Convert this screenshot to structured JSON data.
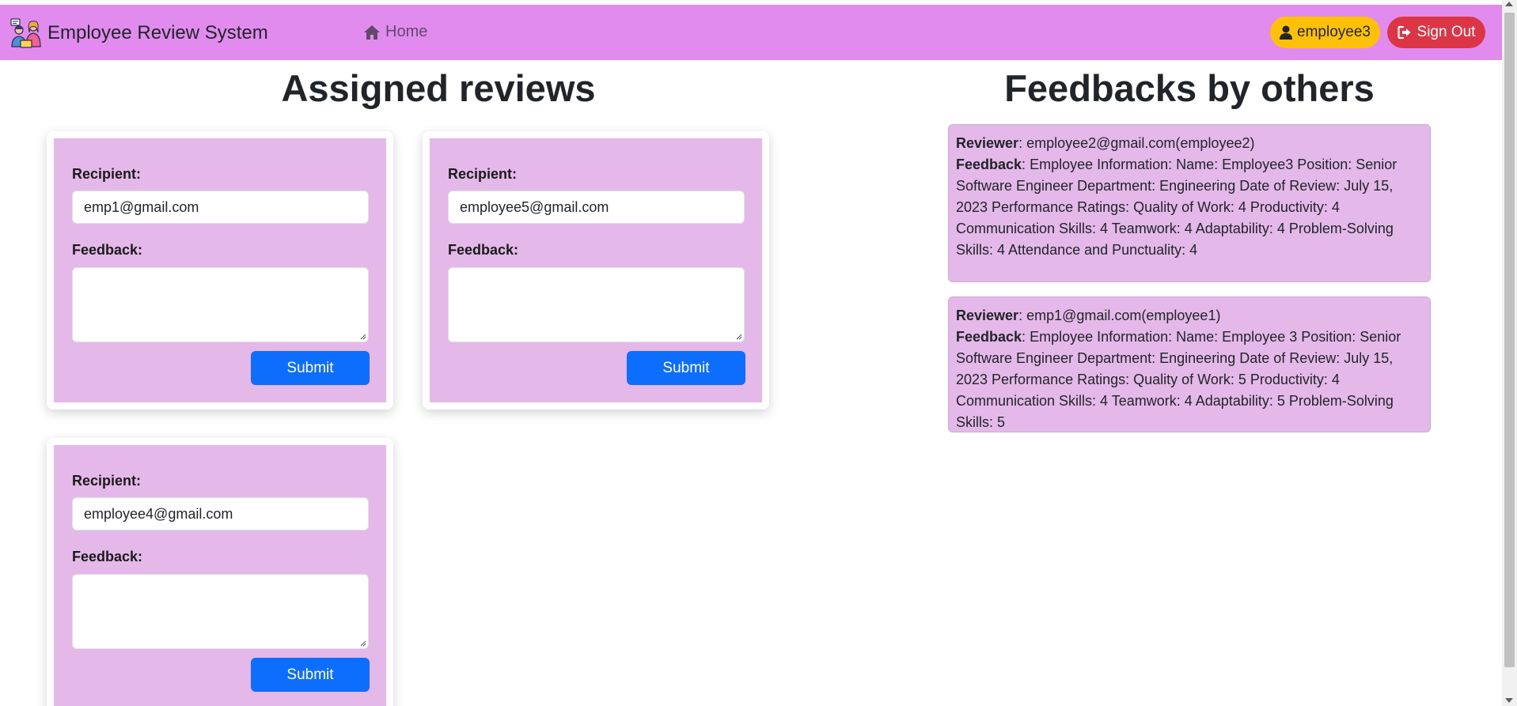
{
  "navbar": {
    "brand": "Employee Review System",
    "home_label": "Home",
    "user_label": "employee3",
    "signout_label": "Sign Out",
    "colors": {
      "navbar": "#e18bee",
      "user": "#ffc107",
      "signout": "#dc3545"
    },
    "icons": [
      "employees-logo-icon",
      "home-icon",
      "user-icon",
      "sign-out-icon"
    ]
  },
  "assigned": {
    "title": "Assigned reviews",
    "recipient_label": "Recipient:",
    "feedback_label": "Feedback:",
    "submit_label": "Submit",
    "reviews": [
      {
        "recipient": "emp1@gmail.com",
        "feedback": ""
      },
      {
        "recipient": "employee5@gmail.com",
        "feedback": ""
      },
      {
        "recipient": "employee4@gmail.com",
        "feedback": ""
      }
    ]
  },
  "feedbacks": {
    "title": "Feedbacks by others",
    "reviewer_label": "Reviewer",
    "feedback_label": "Feedback",
    "items": [
      {
        "reviewer": "employee2@gmail.com(employee2)",
        "text": "Employee Information: Name: Employee3 Position: Senior Software Engineer Department: Engineering Date of Review: July 15, 2023 Performance Ratings: Quality of Work: 4 Productivity: 4 Communication Skills: 4 Teamwork: 4 Adaptability: 4 Problem-Solving Skills: 4 Attendance and Punctuality: 4"
      },
      {
        "reviewer": "emp1@gmail.com(employee1)",
        "text": "Employee Information: Name: Employee 3 Position: Senior Software Engineer Department: Engineering Date of Review: July 15, 2023 Performance Ratings: Quality of Work: 5 Productivity: 4 Communication Skills: 4 Teamwork: 4 Adaptability: 5 Problem-Solving Skills: 5"
      }
    ]
  }
}
